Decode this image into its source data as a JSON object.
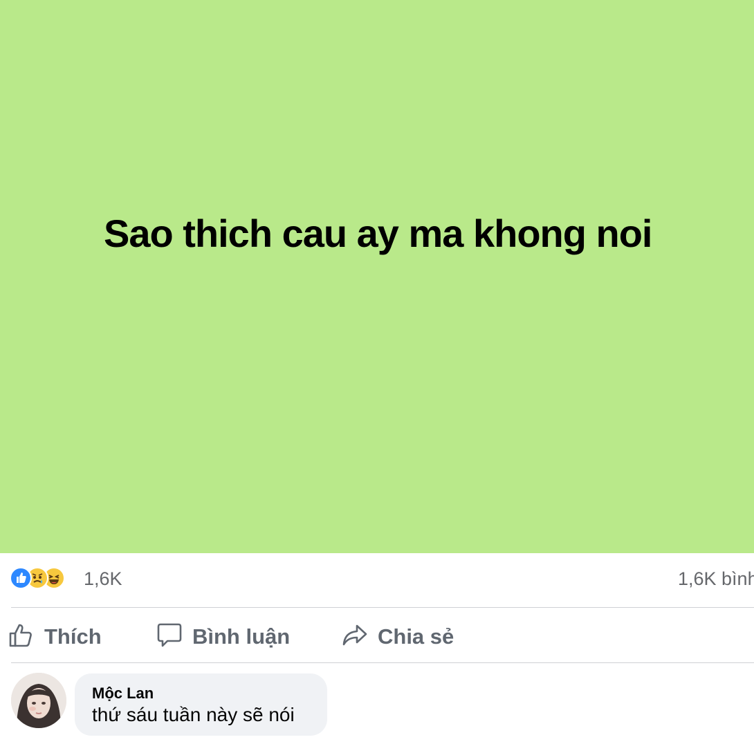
{
  "post": {
    "text": "Sao thich cau ay ma khong noi",
    "background_color": "#b9e98a"
  },
  "reactions": {
    "icons": [
      "like-icon",
      "sad-icon",
      "haha-icon"
    ],
    "count": "1,6K",
    "comments_label": "1,6K bình"
  },
  "actions": {
    "like_label": "Thích",
    "comment_label": "Bình luận",
    "share_label": "Chia sẻ"
  },
  "comment": {
    "author": "Mộc Lan",
    "text": "thứ sáu tuần này sẽ nói"
  }
}
